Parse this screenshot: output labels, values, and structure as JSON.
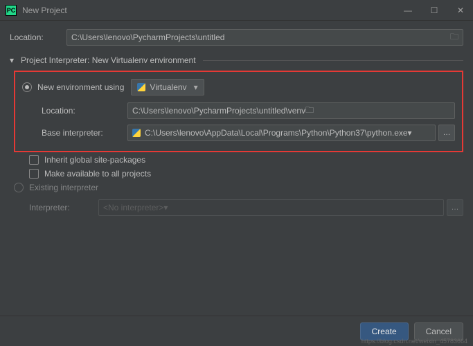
{
  "titlebar": {
    "title": "New Project"
  },
  "location": {
    "label": "Location:",
    "value": "C:\\Users\\lenovo\\PycharmProjects\\untitled"
  },
  "section": {
    "title": "Project Interpreter: New Virtualenv environment"
  },
  "newEnv": {
    "radio_label": "New environment using",
    "tool": "Virtualenv",
    "location_label": "Location:",
    "location_value": "C:\\Users\\lenovo\\PycharmProjects\\untitled\\venv",
    "base_label": "Base interpreter:",
    "base_value": "C:\\Users\\lenovo\\AppData\\Local\\Programs\\Python\\Python37\\python.exe",
    "inherit_label": "Inherit global site-packages",
    "make_avail_label": "Make available to all projects"
  },
  "existing": {
    "radio_label": "Existing interpreter",
    "interp_label": "Interpreter:",
    "interp_value": "<No interpreter>"
  },
  "footer": {
    "create": "Create",
    "cancel": "Cancel"
  },
  "watermark": "https://blog.csdn.net/weixin_45783664"
}
